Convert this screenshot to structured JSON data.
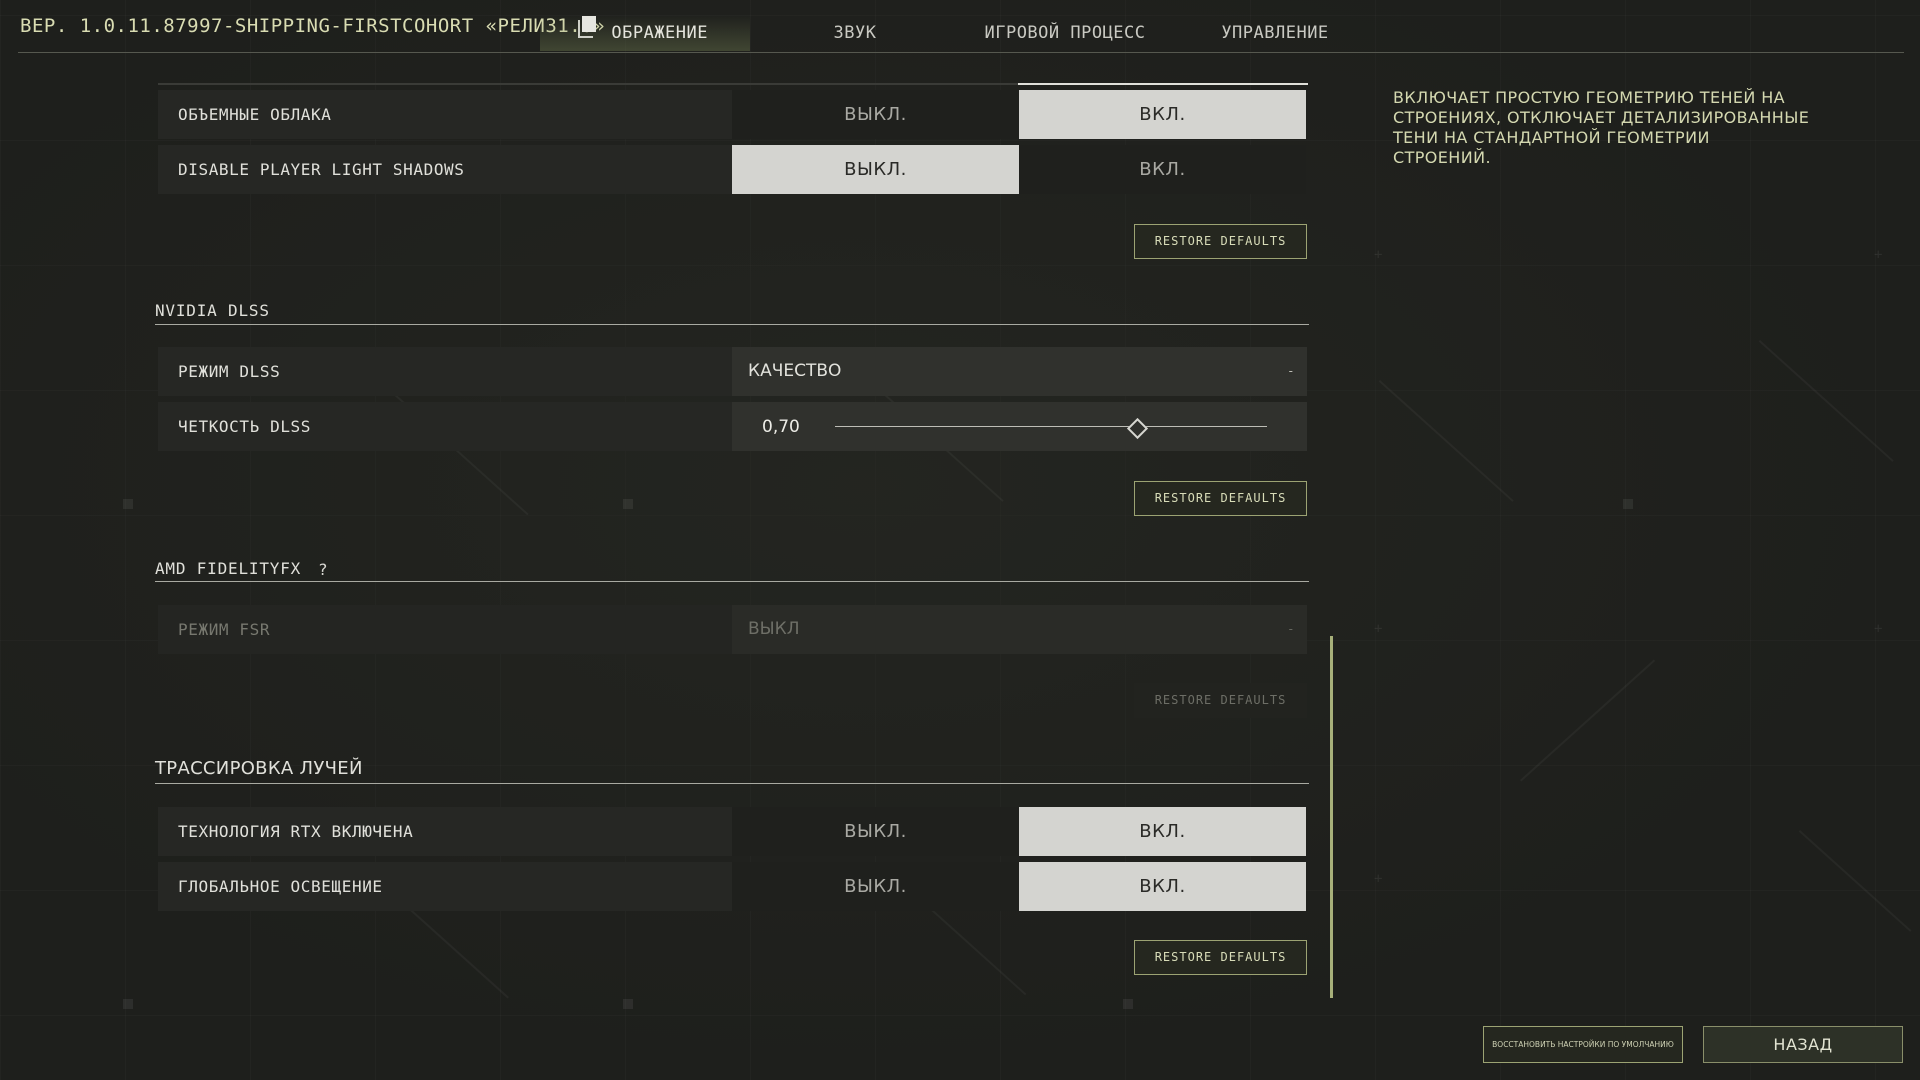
{
  "header": {
    "version": "ВЕР. 1.0.11.87997-SHIPPING-FIRSTCOHORT «РЕЛИЗ1.0»",
    "tabs": [
      {
        "label": "ОБРАЖЕНИЕ",
        "active": true
      },
      {
        "label": "ЗВУК",
        "active": false
      },
      {
        "label": "ИГРОВОЙ ПРОЦЕСС",
        "active": false
      },
      {
        "label": "УПРАВЛЕНИЕ",
        "active": false
      }
    ]
  },
  "options": {
    "off": "ВЫКЛ.",
    "on": "ВКЛ."
  },
  "restore_label": "RESTORE DEFAULTS",
  "shadows_group": {
    "rows": [
      {
        "label": "ОБЪЕМНЫЕ ОБЛАКА",
        "selected": "on"
      },
      {
        "label": "DISABLE PLAYER LIGHT SHADOWS",
        "selected": "off"
      }
    ]
  },
  "dlss": {
    "title": "NVIDIA DLSS",
    "mode": {
      "label": "РЕЖИМ DLSS",
      "value": "КАЧЕСТВО"
    },
    "sharpness": {
      "label": "ЧЕТКОСТЬ DLSS",
      "value": 0.7,
      "value_text": "0,70"
    }
  },
  "fsr": {
    "title": "AMD FIDELITYFX",
    "help": "?",
    "mode": {
      "label": "РЕЖИМ FSR",
      "value": "ВЫКЛ",
      "disabled": true
    }
  },
  "raytracing": {
    "title": "ТРАССИРОВКА ЛУЧЕЙ",
    "rows": [
      {
        "label": "ТЕХНОЛОГИЯ RTX ВКЛЮЧЕНА",
        "selected": "on"
      },
      {
        "label": "ГЛОБАЛЬНОЕ ОСВЕЩЕНИЕ",
        "selected": "on"
      }
    ]
  },
  "description": "ВКЛЮЧАЕТ ПРОСТУЮ ГЕОМЕТРИЮ ТЕНЕЙ НА СТРОЕНИЯХ, ОТКЛЮЧАЕТ ДЕТАЛИЗИРОВАННЫЕ ТЕНИ НА СТАНДАРТНОЙ ГЕОМЕТРИИ СТРОЕНИЙ.",
  "footer": {
    "restore_all": "ВОССТАНОВИТЬ НАСТРОЙКИ ПО УМОЛЧАНИЮ",
    "back": "НАЗАД"
  },
  "colors": {
    "accent": "#a7b07a",
    "selected_option": "#d4d4d0",
    "background": "#1e1f1c"
  },
  "icons": {
    "copy": "copy-icon",
    "dropdown": "chevron-down-icon"
  }
}
